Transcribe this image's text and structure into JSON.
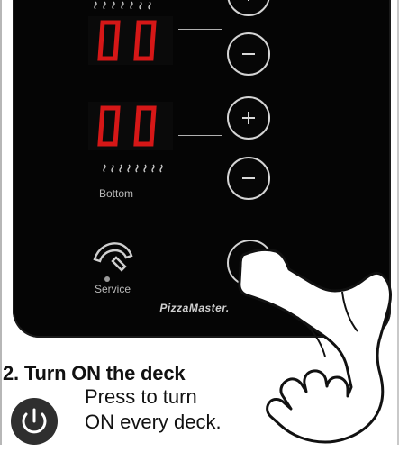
{
  "panel": {
    "upper_display": "00",
    "lower_display": "00",
    "bottom_label": "Bottom",
    "service_label": "Service",
    "brand": "PizzaMaster."
  },
  "buttons": {
    "minus_symbol": "−",
    "plus_symbol": "+"
  },
  "instruction": {
    "title": "2. Turn ON the deck",
    "line1": "Press to turn",
    "line2": "ON every deck."
  },
  "icons": {
    "heat_top": "heating-waves-icon",
    "heat_bottom": "heating-waves-icon",
    "service": "phone-icon",
    "power": "power-icon"
  },
  "colors": {
    "panel_bg": "#050505",
    "display_red": "#d61717",
    "button_outline": "#d4d4d4",
    "text_dark": "#111111"
  }
}
